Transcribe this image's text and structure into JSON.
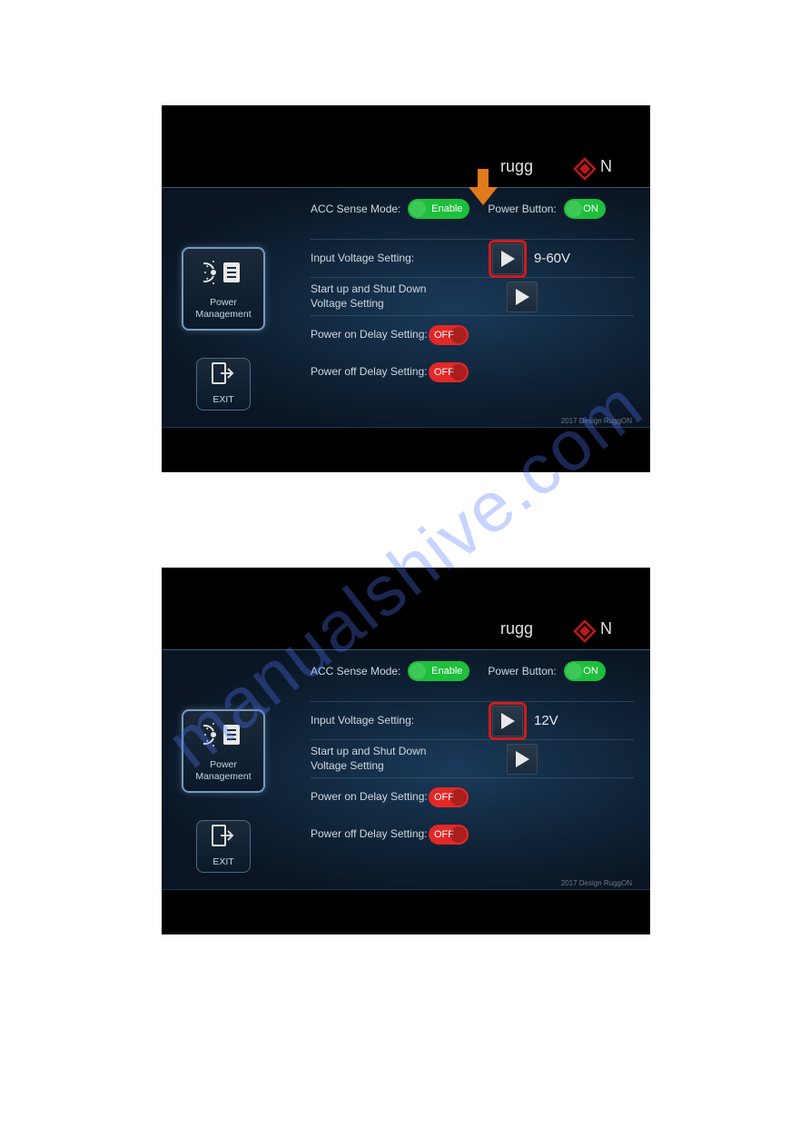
{
  "brand": "ruggON",
  "footer": "2017 Design RuggON",
  "watermark": "manualshive.com",
  "sidebar": {
    "power_management": "Power\nManagement",
    "exit": "EXIT"
  },
  "panel1": {
    "acc_sense_label": "ACC Sense Mode:",
    "acc_sense_value": "Enable",
    "power_button_label": "Power Button:",
    "power_button_value": "ON",
    "input_voltage_label": "Input Voltage Setting:",
    "input_voltage_value": "9-60V",
    "startup_shutdown_label": "Start up and Shut Down\nVoltage Setting",
    "power_on_delay_label": "Power on Delay Setting:",
    "power_on_delay_value": "OFF",
    "power_off_delay_label": "Power off Delay Setting:",
    "power_off_delay_value": "OFF"
  },
  "panel2": {
    "acc_sense_label": "ACC Sense Mode:",
    "acc_sense_value": "Enable",
    "power_button_label": "Power Button:",
    "power_button_value": "ON",
    "input_voltage_label": "Input Voltage Setting:",
    "input_voltage_value": "12V",
    "startup_shutdown_label": "Start up and Shut Down\nVoltage Setting",
    "power_on_delay_label": "Power on Delay Setting:",
    "power_on_delay_value": "OFF",
    "power_off_delay_label": "Power off Delay Setting:",
    "power_off_delay_value": "OFF"
  }
}
